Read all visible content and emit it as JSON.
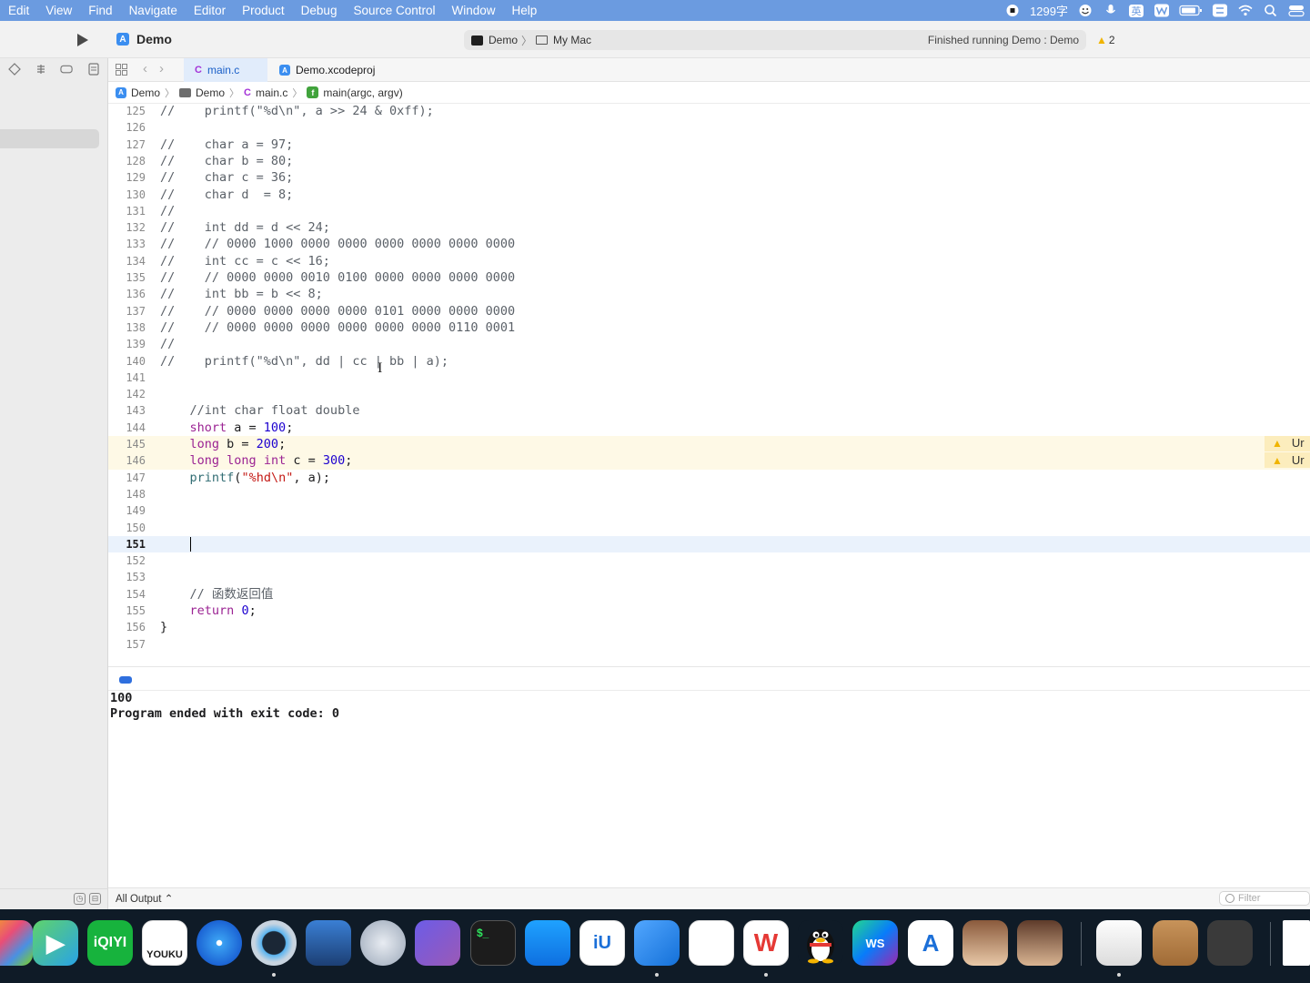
{
  "menubar": {
    "items": [
      "Edit",
      "View",
      "Find",
      "Navigate",
      "Editor",
      "Product",
      "Debug",
      "Source Control",
      "Window",
      "Help"
    ],
    "word_count": "1299字",
    "input_method": "英"
  },
  "toolbar": {
    "project": "Demo",
    "scheme_target": "Demo",
    "scheme_destination": "My Mac",
    "status": "Finished running Demo : Demo",
    "warning_count": "2"
  },
  "tabs": [
    {
      "badge": "C",
      "label": "main.c",
      "active": true
    },
    {
      "badge": "",
      "label": "Demo.xcodeproj",
      "active": false
    }
  ],
  "jumpbar": {
    "project": "Demo",
    "folder": "Demo",
    "file_badge": "C",
    "file": "main.c",
    "func_badge": "f",
    "function": "main(argc, argv)"
  },
  "editor": {
    "current_line": 151,
    "warning_text": "Ur",
    "lines": [
      {
        "n": "125",
        "text": "//    printf(\"%d\\n\", a >> 24 & 0xff);"
      },
      {
        "n": "126",
        "text": ""
      },
      {
        "n": "127",
        "text": "//    char a = 97;"
      },
      {
        "n": "128",
        "text": "//    char b = 80;"
      },
      {
        "n": "129",
        "text": "//    char c = 36;"
      },
      {
        "n": "130",
        "text": "//    char d  = 8;"
      },
      {
        "n": "131",
        "text": "//"
      },
      {
        "n": "132",
        "text": "//    int dd = d << 24;"
      },
      {
        "n": "133",
        "text": "//    // 0000 1000 0000 0000 0000 0000 0000 0000"
      },
      {
        "n": "134",
        "text": "//    int cc = c << 16;"
      },
      {
        "n": "135",
        "text": "//    // 0000 0000 0010 0100 0000 0000 0000 0000"
      },
      {
        "n": "136",
        "text": "//    int bb = b << 8;"
      },
      {
        "n": "137",
        "text": "//    // 0000 0000 0000 0000 0101 0000 0000 0000"
      },
      {
        "n": "138",
        "text": "//    // 0000 0000 0000 0000 0000 0000 0110 0001"
      },
      {
        "n": "139",
        "text": "//"
      },
      {
        "n": "140",
        "text": "//    printf(\"%d\\n\", dd | cc | bb | a);"
      },
      {
        "n": "141",
        "text": ""
      },
      {
        "n": "142",
        "text": ""
      },
      {
        "n": "143",
        "text": "    //int char float double"
      },
      {
        "n": "144",
        "text": "    short a = 100;"
      },
      {
        "n": "145",
        "text": "    long b = 200;",
        "warning": true
      },
      {
        "n": "146",
        "text": "    long long int c = 300;",
        "warning": true
      },
      {
        "n": "147",
        "text": "    printf(\"%hd\\n\", a);"
      },
      {
        "n": "148",
        "text": ""
      },
      {
        "n": "149",
        "text": ""
      },
      {
        "n": "150",
        "text": ""
      },
      {
        "n": "151",
        "text": "    ",
        "current": true
      },
      {
        "n": "152",
        "text": ""
      },
      {
        "n": "153",
        "text": ""
      },
      {
        "n": "154",
        "text": "    // 函数返回值"
      },
      {
        "n": "155",
        "text": "    return 0;"
      },
      {
        "n": "156",
        "text": "}"
      },
      {
        "n": "157",
        "text": ""
      }
    ]
  },
  "console": {
    "lines": [
      "100",
      "Program ended with exit code: 0"
    ],
    "output_selector": "All Output ⌃",
    "filter_placeholder": "Filter"
  },
  "dock": {
    "apps": [
      {
        "name": "launchpad",
        "label": ""
      },
      {
        "name": "video-player",
        "label": "▶"
      },
      {
        "name": "iqiyi",
        "label": "iQIYI"
      },
      {
        "name": "youku",
        "label": "YOUKU"
      },
      {
        "name": "safari",
        "label": ""
      },
      {
        "name": "quicktime",
        "label": ""
      },
      {
        "name": "anymp4",
        "label": ""
      },
      {
        "name": "instruments",
        "label": ""
      },
      {
        "name": "imovie",
        "label": ""
      },
      {
        "name": "terminal",
        "label": "$_"
      },
      {
        "name": "app-store",
        "label": ""
      },
      {
        "name": "iu",
        "label": "iU"
      },
      {
        "name": "xcode",
        "label": ""
      },
      {
        "name": "baidu-netdisk",
        "label": ""
      },
      {
        "name": "wps",
        "label": "W"
      },
      {
        "name": "qq",
        "label": ""
      },
      {
        "name": "webstorm",
        "label": "WS"
      },
      {
        "name": "app-dev",
        "label": "A"
      },
      {
        "name": "photo-app-1",
        "label": ""
      },
      {
        "name": "photo-app-2",
        "label": ""
      },
      {
        "name": "textedit",
        "label": ""
      },
      {
        "name": "contacts",
        "label": ""
      },
      {
        "name": "calculator",
        "label": ""
      },
      {
        "name": "finder-window",
        "label": ""
      }
    ]
  }
}
